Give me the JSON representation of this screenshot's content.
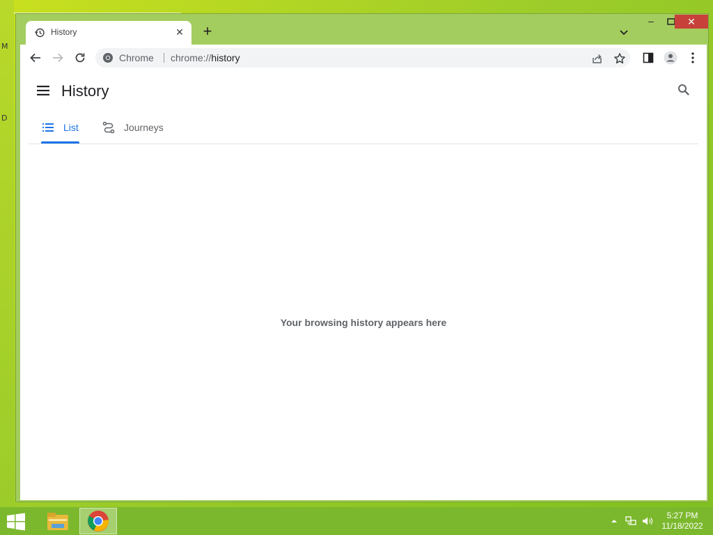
{
  "desktop": {
    "letters": [
      "M",
      "D"
    ]
  },
  "browser": {
    "tab": {
      "title": "History",
      "close_symbol": "✕"
    },
    "new_tab_symbol": "+",
    "window_controls": {
      "minimize": "–",
      "close": "✕"
    },
    "omnibox": {
      "chip": "Chrome",
      "url_scheme": "chrome://",
      "url_host": "history"
    }
  },
  "page": {
    "title": "History",
    "tabs": [
      {
        "label": "List",
        "selected": true
      },
      {
        "label": "Journeys",
        "selected": false
      }
    ],
    "empty_message": "Your browsing history appears here"
  },
  "colors": {
    "accent": "#1a73e8",
    "inactive_tab": "#5f6368"
  },
  "taskbar": {
    "apps": [
      "file-explorer",
      "chrome"
    ],
    "time": "5:27 PM",
    "date": "11/18/2022"
  }
}
